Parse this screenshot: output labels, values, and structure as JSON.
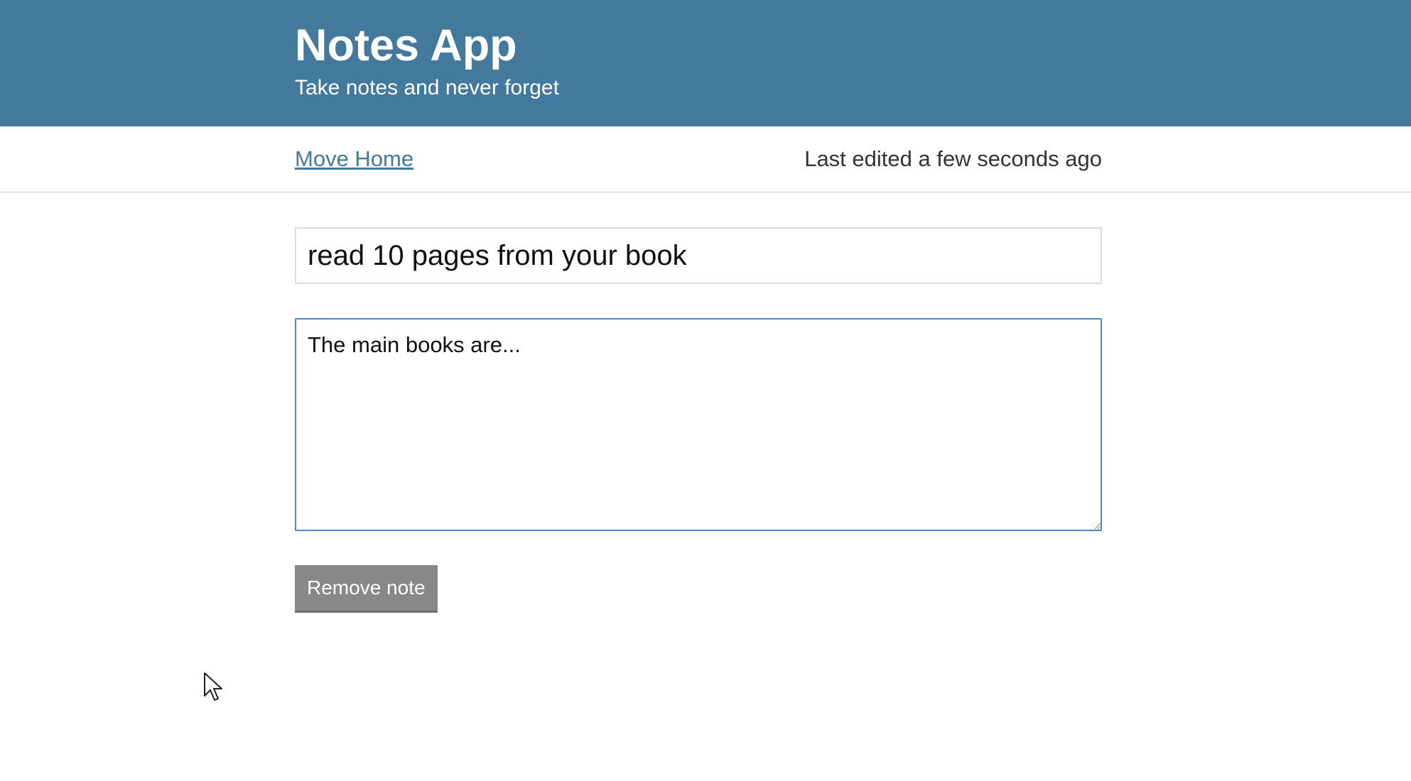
{
  "header": {
    "title": "Notes App",
    "subtitle": "Take notes and never forget"
  },
  "actionbar": {
    "home_link": "Move Home",
    "last_edited": "Last edited a few seconds ago"
  },
  "note": {
    "title_value": "read 10 pages from your book",
    "body_value": "The main books are..."
  },
  "buttons": {
    "remove_label": "Remove note"
  },
  "colors": {
    "header_bg": "#43799c",
    "link": "#43799c",
    "focus_border": "#4a86d1",
    "button_bg": "#888888"
  },
  "icons": {
    "cursor": "mouse-pointer-icon"
  }
}
